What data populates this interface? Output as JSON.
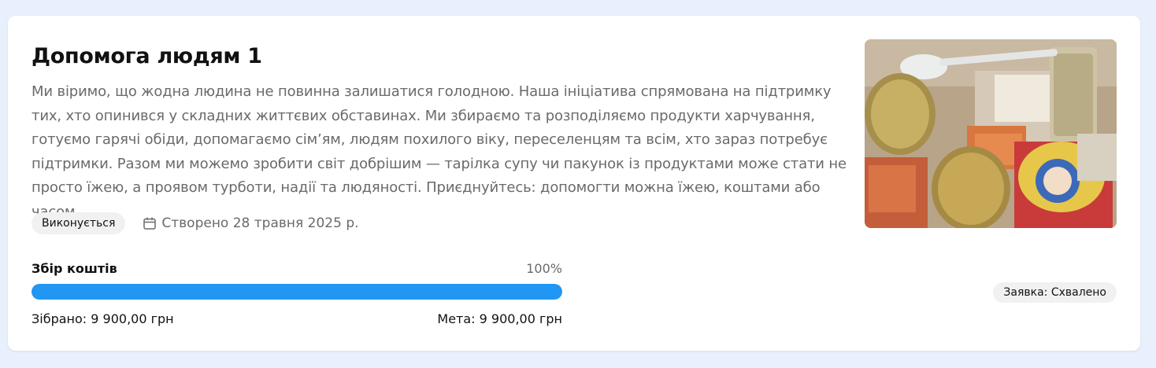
{
  "card": {
    "title": "Допомога людям 1",
    "description": "Ми віримо, що жодна людина не повинна залишатися голодною. Наша ініціатива спрямована на підтримку тих, хто опинився у складних життєвих обставинах. Ми збираємо та розподіляємо продукти харчування, готуємо гарячі обіди, допомагаємо сім’ям, людям похилого віку, переселенцям та всім, хто зараз потребує підтримки. Разом ми можемо зробити світ добрішим — тарілка супу чи пакунок із продуктами може стати не просто їжею, а проявом турботи, надії та людяності. Приєднуйтесь: допомогти можна їжею, коштами або часом.",
    "status": "Виконується",
    "created": "Створено 28 травня 2025 р.",
    "calendar_icon": "calendar-icon",
    "photo_label": "food-package-photo"
  },
  "fundraising": {
    "title": "Збір коштів",
    "percent_label": "100%",
    "progress_fraction": 1.0,
    "collected": "Зібрано: 9 900,00 грн",
    "goal": "Мета: 9 900,00 грн",
    "bar_color": "#2196f3"
  },
  "request_status": "Заявка: Схвалено"
}
